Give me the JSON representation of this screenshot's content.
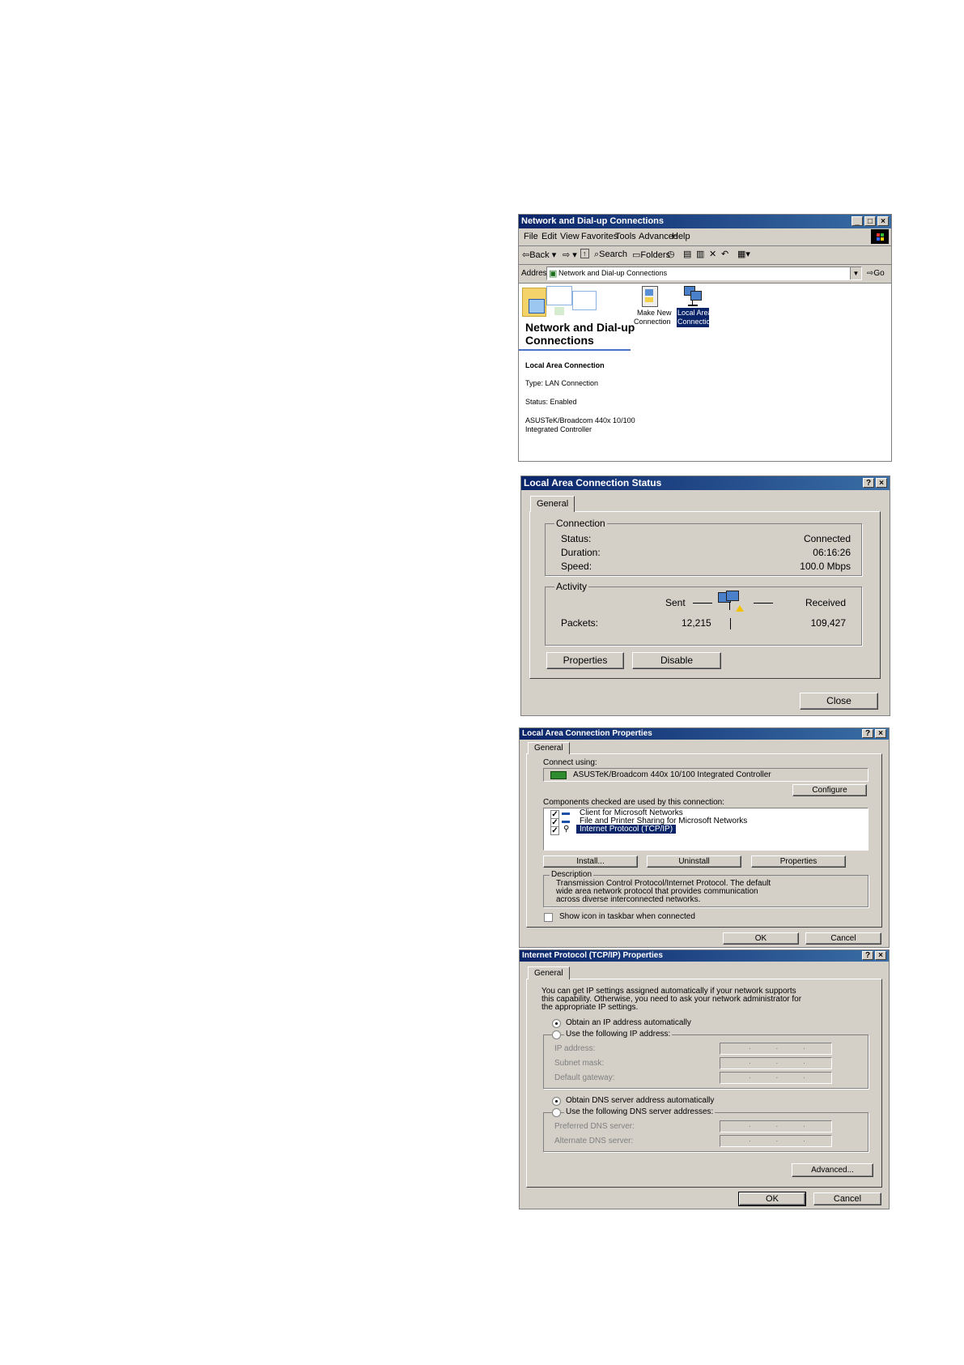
{
  "explorer": {
    "title": "Network and Dial-up Connections",
    "menu": [
      "File",
      "Edit",
      "View",
      "Favorites",
      "Tools",
      "Advanced",
      "Help"
    ],
    "toolbar": {
      "back": "Back",
      "search": "Search",
      "folders": "Folders"
    },
    "address_label": "Address",
    "address_value": "Network and Dial-up Connections",
    "go_label": "Go",
    "panel_title_1": "Network and Dial-up",
    "panel_title_2": "Connections",
    "selected_name": "Local Area Connection",
    "type_text": "Type: LAN Connection",
    "status_text": "Status: Enabled",
    "adapter_line_1": "ASUSTeK/Broadcom 440x 10/100",
    "adapter_line_2": "Integrated Controller",
    "icons": [
      {
        "line1": "Make New",
        "line2": "Connection"
      },
      {
        "line1": "Local Area",
        "line2": "Connection"
      }
    ]
  },
  "status_dialog": {
    "title": "Local Area Connection Status",
    "tab": "General",
    "connection_group": "Connection",
    "status_label": "Status:",
    "status_value": "Connected",
    "duration_label": "Duration:",
    "duration_value": "06:16:26",
    "speed_label": "Speed:",
    "speed_value": "100.0 Mbps",
    "activity_group": "Activity",
    "sent_label": "Sent",
    "received_label": "Received",
    "packets_label": "Packets:",
    "packets_sent": "12,215",
    "packets_received": "109,427",
    "properties_button": "Properties",
    "disable_button": "Disable",
    "close_button": "Close"
  },
  "properties_dialog": {
    "title": "Local Area Connection Properties",
    "tab": "General",
    "connect_using": "Connect using:",
    "adapter": "ASUSTeK/Broadcom 440x 10/100 Integrated Controller",
    "configure_button": "Configure",
    "components_label": "Components checked are used by this connection:",
    "components": [
      "Client for Microsoft Networks",
      "File and Printer Sharing for Microsoft Networks",
      "Internet Protocol (TCP/IP)"
    ],
    "install_button": "Install...",
    "uninstall_button": "Uninstall",
    "properties_button": "Properties",
    "description_group": "Description",
    "description_1": "Transmission Control Protocol/Internet Protocol. The default",
    "description_2": "wide area network protocol that provides communication",
    "description_3": "across diverse interconnected networks.",
    "show_icon_label": "Show icon in taskbar when connected",
    "ok_button": "OK",
    "cancel_button": "Cancel"
  },
  "tcpip_dialog": {
    "title": "Internet Protocol (TCP/IP) Properties",
    "tab": "General",
    "intro_1": "You can get IP settings assigned automatically if your network supports",
    "intro_2": "this capability. Otherwise, you need to ask your network administrator for",
    "intro_3": "the appropriate IP settings.",
    "obtain_ip": "Obtain an IP address automatically",
    "use_ip": "Use the following IP address:",
    "ip_label": "IP address:",
    "subnet_label": "Subnet mask:",
    "gateway_label": "Default gateway:",
    "obtain_dns": "Obtain DNS server address automatically",
    "use_dns": "Use the following DNS server addresses:",
    "preferred_dns_label": "Preferred DNS server:",
    "alternate_dns_label": "Alternate DNS server:",
    "ip_dots": ". . .",
    "advanced_button": "Advanced...",
    "ok_button": "OK",
    "cancel_button": "Cancel"
  }
}
